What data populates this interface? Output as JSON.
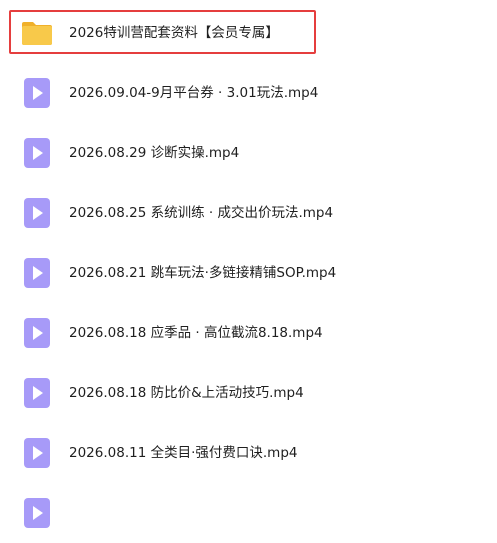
{
  "colors": {
    "highlight": "#e53e3e",
    "folder": "#f6c344",
    "video": "#a79af8"
  },
  "files": [
    {
      "name": "2026特训营配套资料【会员专属】",
      "icon": "folder-icon",
      "selected": true
    },
    {
      "name": "2026.09.04-9月平台券 · 3.01玩法.mp4",
      "icon": "video-file-icon"
    },
    {
      "name": "2026.08.29 诊断实操.mp4",
      "icon": "video-file-icon"
    },
    {
      "name": "2026.08.25 系统训练 · 成交出价玩法.mp4",
      "icon": "video-file-icon"
    },
    {
      "name": "2026.08.21 跳车玩法·多链接精铺SOP.mp4",
      "icon": "video-file-icon"
    },
    {
      "name": "2026.08.18 应季品 · 高位截流8.18.mp4",
      "icon": "video-file-icon"
    },
    {
      "name": "2026.08.18 防比价&上活动技巧.mp4",
      "icon": "video-file-icon"
    },
    {
      "name": "2026.08.11 全类目·强付费口诀.mp4",
      "icon": "video-file-icon"
    }
  ]
}
